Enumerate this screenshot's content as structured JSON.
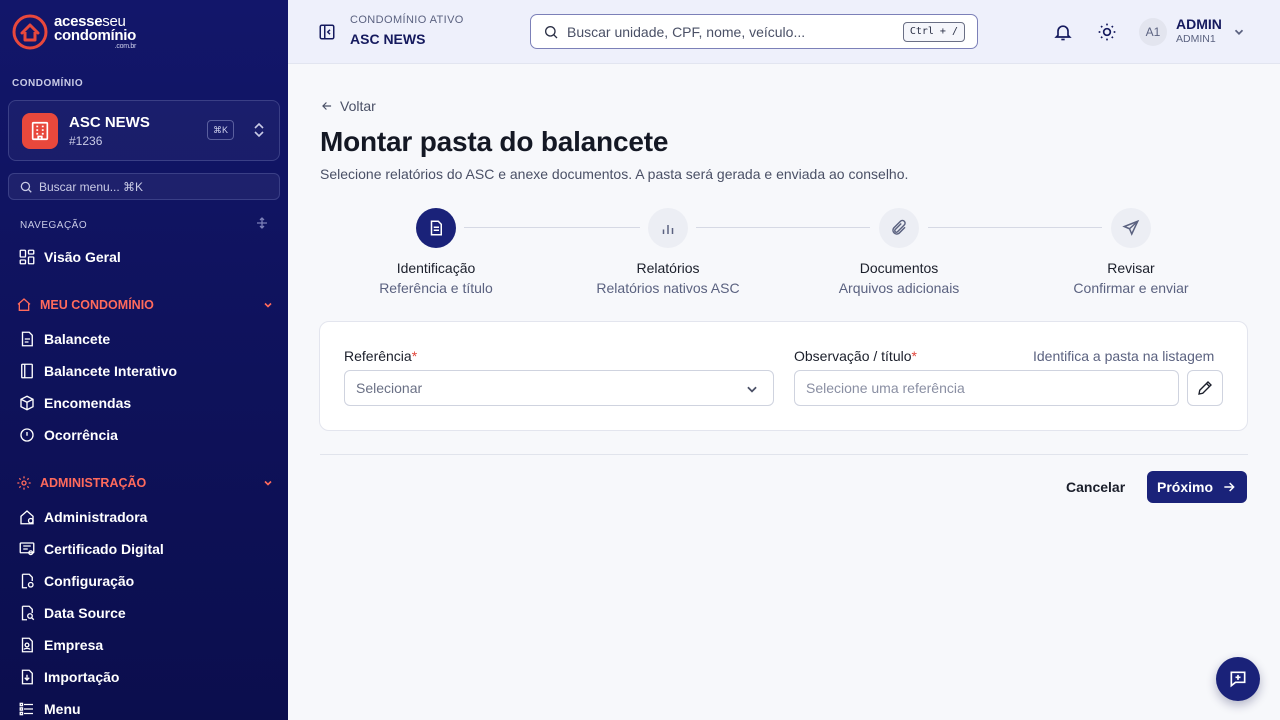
{
  "brand": {
    "line1_bold": "acesse",
    "line1_light": "seu",
    "line2": "condomínio",
    "line3": ".com.br"
  },
  "sidebar": {
    "condo_section_label": "CONDOMÍNIO",
    "condo": {
      "name": "ASC NEWS",
      "id": "#1236",
      "shortcut": "⌘K"
    },
    "search_placeholder": "Buscar menu... ⌘K",
    "nav_label": "NAVEGAÇÃO",
    "overview": "Visão Geral",
    "group_meu": "MEU CONDOMÍNIO",
    "meu_items": [
      "Balancete",
      "Balancete Interativo",
      "Encomendas",
      "Ocorrência"
    ],
    "group_admin": "ADMINISTRAÇÃO",
    "admin_items": [
      "Administradora",
      "Certificado Digital",
      "Configuração",
      "Data Source",
      "Empresa",
      "Importação",
      "Menu"
    ]
  },
  "topbar": {
    "active_label": "CONDOMÍNIO ATIVO",
    "active_name": "ASC NEWS",
    "search_placeholder": "Buscar unidade, CPF, nome, veículo...",
    "search_shortcut": "Ctrl + /",
    "avatar_initials": "A1",
    "user_name": "ADMIN",
    "user_role": "ADMIN1"
  },
  "page": {
    "back_label": "Voltar",
    "title": "Montar pasta do balancete",
    "subtitle": "Selecione relatórios do ASC e anexe documentos. A pasta será gerada e enviada ao conselho."
  },
  "steps": [
    {
      "title": "Identificação",
      "subtitle": "Referência e título",
      "icon": "document-icon",
      "active": true
    },
    {
      "title": "Relatórios",
      "subtitle": "Relatórios nativos ASC",
      "icon": "bar-chart-icon",
      "active": false
    },
    {
      "title": "Documentos",
      "subtitle": "Arquivos adicionais",
      "icon": "paperclip-icon",
      "active": false
    },
    {
      "title": "Revisar",
      "subtitle": "Confirmar e enviar",
      "icon": "send-icon",
      "active": false
    }
  ],
  "form": {
    "referencia_label": "Referência",
    "referencia_value": "Selecionar",
    "observacao_label": "Observação / título",
    "observacao_hint": "Identifica a pasta na listagem",
    "observacao_placeholder": "Selecione uma referência",
    "required_mark": "*"
  },
  "actions": {
    "cancel": "Cancelar",
    "next": "Próximo"
  },
  "colors": {
    "sidebar_bg": "#12166a",
    "accent": "#e8483c",
    "primary": "#1a2279"
  }
}
